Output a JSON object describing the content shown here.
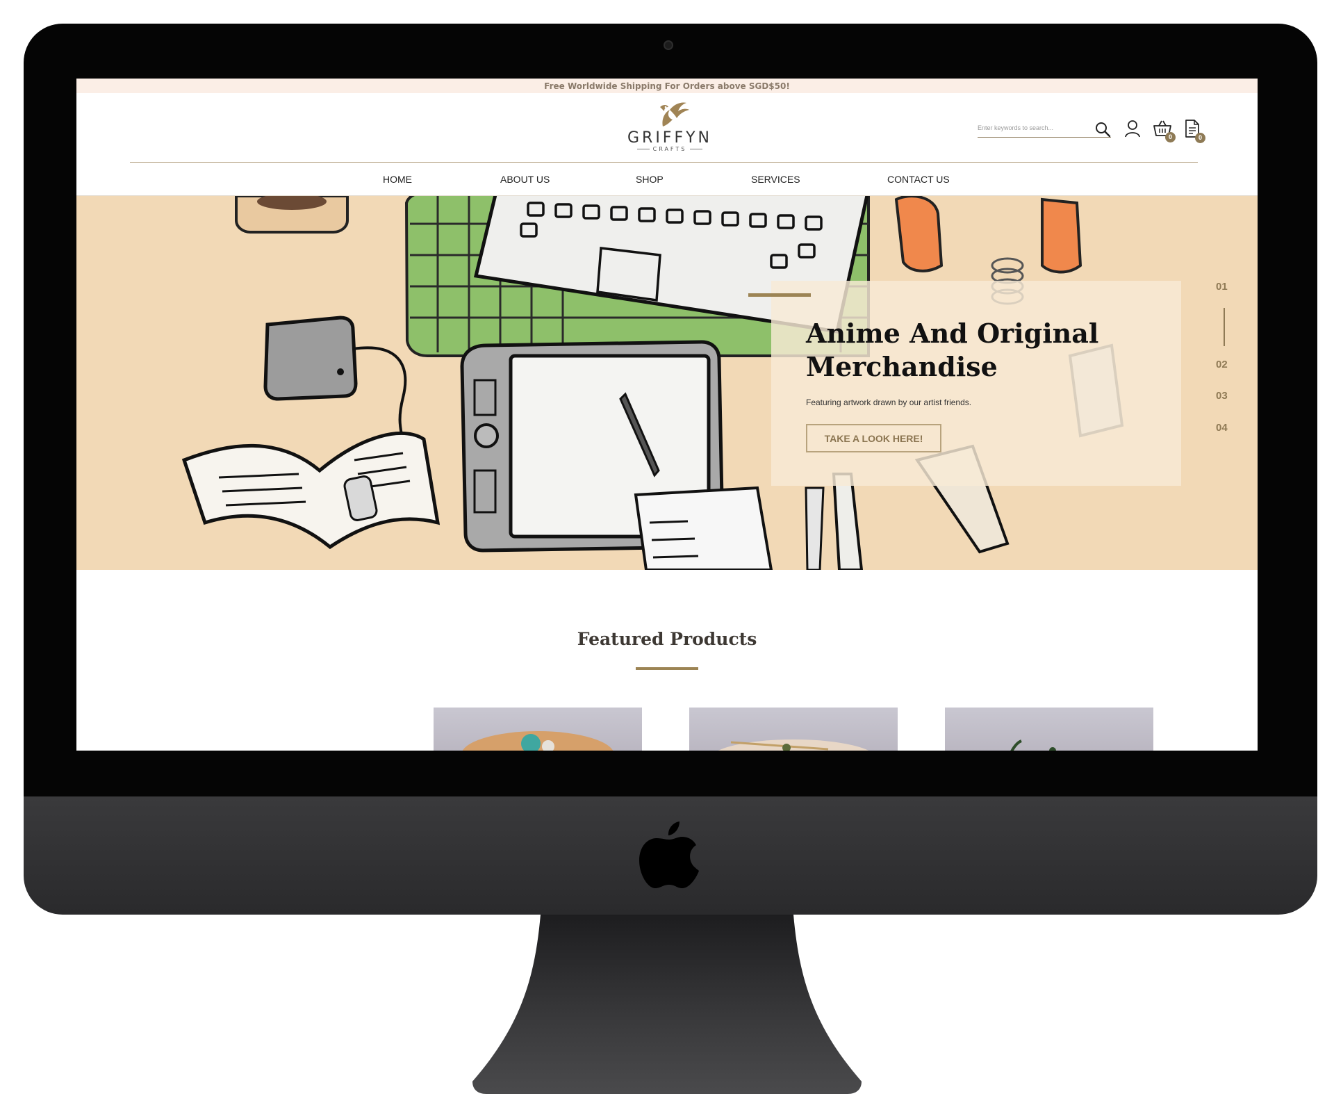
{
  "announcement": "Free Worldwide Shipping For Orders above SGD$50!",
  "brand": {
    "name": "GRIFFYN",
    "tagline": "CRAFTS"
  },
  "search": {
    "placeholder": "Enter keywords to search..."
  },
  "header_icons": {
    "search": "search-icon",
    "account": "user-icon",
    "cart": "cart-icon",
    "wishlist": "list-icon"
  },
  "cart_count": "0",
  "list_count": "0",
  "nav": [
    {
      "label": "HOME"
    },
    {
      "label": "ABOUT US"
    },
    {
      "label": "SHOP"
    },
    {
      "label": "SERVICES"
    },
    {
      "label": "CONTACT US"
    }
  ],
  "hero": {
    "title": "Anime And Original Merchandise",
    "subtitle": "Featuring artwork drawn by our artist friends.",
    "button": "TAKE A LOOK HERE!",
    "slides": [
      "01",
      "02",
      "03",
      "04"
    ],
    "active_slide": "01"
  },
  "featured": {
    "title": "Featured Products"
  },
  "colors": {
    "accent": "#9c8454",
    "announcement_bg": "#fbeee6",
    "hero_bg": "#f2d9b6"
  }
}
